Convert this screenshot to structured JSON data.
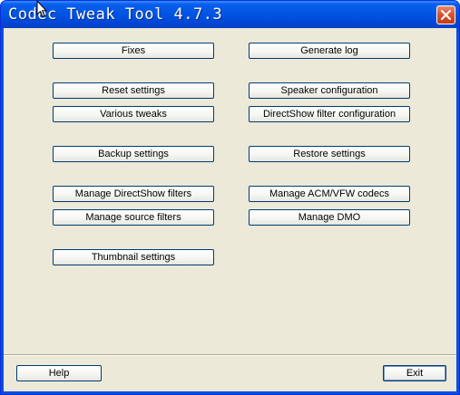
{
  "window": {
    "title": "Codec Tweak Tool 4.7.3"
  },
  "buttons": {
    "fixes": "Fixes",
    "generate_log": "Generate log",
    "reset_settings": "Reset settings",
    "speaker_configuration": "Speaker configuration",
    "various_tweaks": "Various tweaks",
    "directshow_filter_configuration": "DirectShow filter configuration",
    "backup_settings": "Backup settings",
    "restore_settings": "Restore settings",
    "manage_directshow_filters": "Manage DirectShow filters",
    "manage_acm_vfw_codecs": "Manage ACM/VFW codecs",
    "manage_source_filters": "Manage source filters",
    "manage_dmo": "Manage DMO",
    "thumbnail_settings": "Thumbnail settings",
    "help": "Help",
    "exit": "Exit"
  },
  "colors": {
    "titlebar": "#0054e3",
    "client_background": "#ece9d8",
    "close_button": "#d8532e",
    "button_border": "#003c74"
  },
  "icons": {
    "close": "close-icon",
    "cursor": "mouse-cursor-icon"
  }
}
